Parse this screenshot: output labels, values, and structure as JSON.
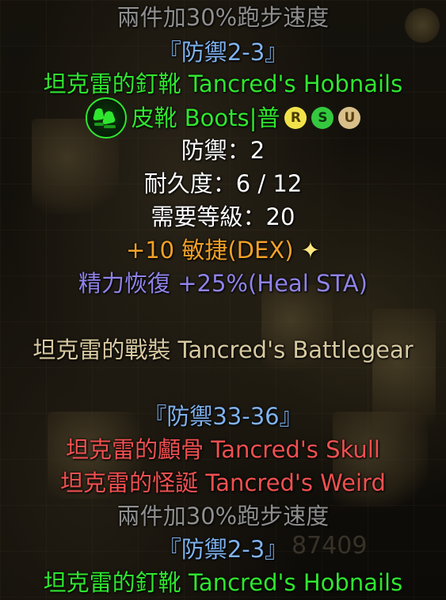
{
  "set_bonus_top": "兩件加30%跑步速度",
  "defense_range_top": "『防禦2-3』",
  "item_name": "坦克雷的釘靴 Tancred's Hobnails",
  "item_type": "皮靴 Boots|普",
  "badges": [
    "R",
    "S",
    "U"
  ],
  "defense": "防禦：2",
  "durability": "耐久度：6 / 12",
  "required_level": "需要等級：20",
  "stat_dex": "+10 敏捷(DEX)",
  "star": "✦",
  "stat_heal": "精力恢復 +25%(Heal STA)",
  "set_name": "坦克雷的戰裝 Tancred's Battlegear",
  "set_defense_range": "『防禦33-36』",
  "set_items": [
    "坦克雷的顱骨 Tancred's Skull",
    "坦克雷的怪誕 Tancred's Weird"
  ],
  "set_bonus_bottom": "兩件加30%跑步速度",
  "defense_range_bottom": "『防禦2-3』",
  "item_name_bottom": "坦克雷的釘靴 Tancred's Hobnails",
  "background_number": "87409",
  "colors": {
    "gray": "#8f8f8f",
    "blue": "#7fb2ee",
    "green": "#2fe62f",
    "orange": "#f2a127",
    "purple": "#8f83e8",
    "tan": "#d8c9a0",
    "red": "#ef5050"
  },
  "icons": {
    "item": "boots-icon",
    "badge_r": "rare-badge-icon",
    "badge_s": "set-badge-icon",
    "badge_u": "unique-badge-icon",
    "star": "star-icon"
  }
}
